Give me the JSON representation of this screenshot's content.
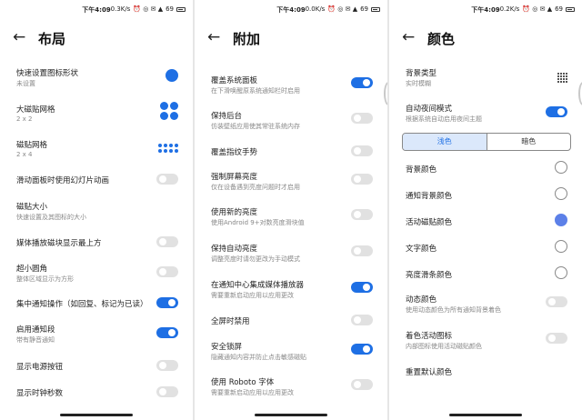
{
  "status": {
    "time": "下午4:09",
    "speeds": [
      "...0.3K/s",
      "...0.0K/s",
      "...0.2K/s"
    ],
    "battery": "69"
  },
  "panels": [
    {
      "title": "布局",
      "rows": [
        {
          "t": "快速设置图标形状",
          "s": "未设置"
        },
        {
          "t": "大磁贴网格",
          "s": "2 x 2"
        },
        {
          "t": "磁贴网格",
          "s": "2 x 4"
        },
        {
          "t": "滑动面板时使用幻灯片动画",
          "s": ""
        },
        {
          "t": "磁贴大小",
          "s": "快速设置及其图标的大小"
        },
        {
          "t": "媒体播放磁块显示最上方",
          "s": ""
        },
        {
          "t": "超小圆角",
          "s": "整体区域显示为方形"
        },
        {
          "t": "集中通知操作（如回复、标记为已读）",
          "s": ""
        },
        {
          "t": "启用通知段",
          "s": "带有静音通知"
        },
        {
          "t": "显示电源按钮",
          "s": ""
        },
        {
          "t": "显示时钟秒数",
          "s": ""
        }
      ]
    },
    {
      "title": "附加",
      "rows": [
        {
          "t": "覆盖系统面板",
          "s": "在下滑唤醒原系统通知栏时启用"
        },
        {
          "t": "保持后台",
          "s": "仿装壁纸应用使其常驻系统内存"
        },
        {
          "t": "覆盖指纹手势",
          "s": ""
        },
        {
          "t": "强制屏幕亮度",
          "s": "仅在设备遇到亮度问题时才启用"
        },
        {
          "t": "使用新的亮度",
          "s": "使用Android 9+对数亮度滑块值"
        },
        {
          "t": "保持自动亮度",
          "s": "调整亮度时请勿更改为手动模式"
        },
        {
          "t": "在通知中心集成媒体播放器",
          "s": "需要重新启动应用以应用更改"
        },
        {
          "t": "全屏时禁用",
          "s": ""
        },
        {
          "t": "安全锁屏",
          "s": "隐藏通知内容并防止点击敏感磁贴"
        },
        {
          "t": "使用 Roboto 字体",
          "s": "需要重新启动应用以应用更改"
        }
      ]
    },
    {
      "title": "颜色",
      "top_rows": [
        {
          "t": "背景类型",
          "s": "实时模糊"
        },
        {
          "t": "自动夜间模式",
          "s": "根据系统自动启用夜间主题"
        }
      ],
      "tabs": [
        "浅色",
        "暗色"
      ],
      "rows": [
        {
          "t": "背景颜色",
          "s": ""
        },
        {
          "t": "通知背景颜色",
          "s": ""
        },
        {
          "t": "活动磁贴颜色",
          "s": ""
        },
        {
          "t": "文字颜色",
          "s": ""
        },
        {
          "t": "亮度滑条颜色",
          "s": ""
        },
        {
          "t": "动态颜色",
          "s": "使用动态颜色为所有通知背景着色"
        },
        {
          "t": "着色活动图标",
          "s": "内部图标使用活动磁贴颜色"
        },
        {
          "t": "重置默认颜色",
          "s": ""
        }
      ]
    }
  ],
  "colors": {
    "accent": "#1e6fe4",
    "toggle_off": "#e1e1e1",
    "radio_selected": "#5c80e8"
  }
}
